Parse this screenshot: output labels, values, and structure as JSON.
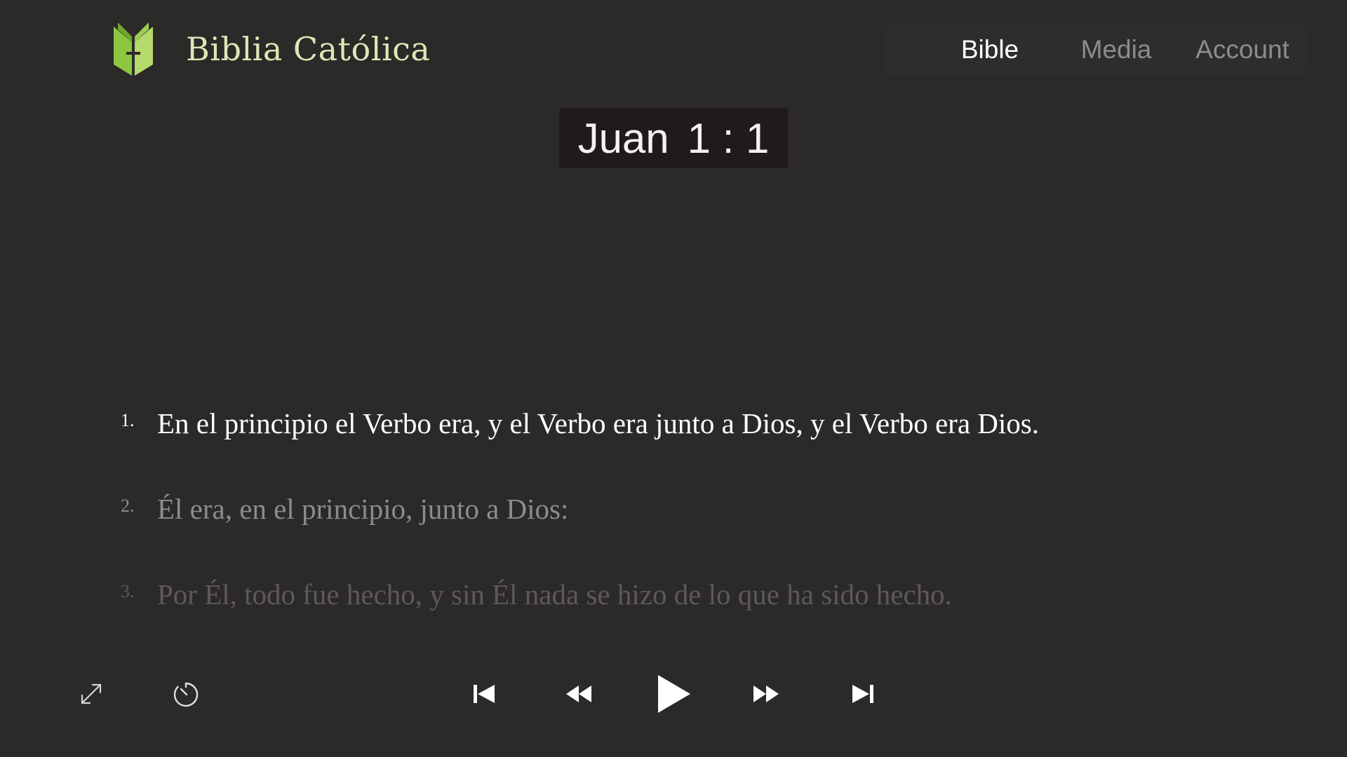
{
  "app": {
    "brand_name": "Biblia Católica"
  },
  "nav": {
    "tabs": [
      {
        "label": "Bible",
        "active": true
      },
      {
        "label": "Media",
        "active": false
      },
      {
        "label": "Account",
        "active": false
      }
    ]
  },
  "reference": {
    "book": "Juan",
    "chapter_verse": "1 : 1"
  },
  "verses": [
    {
      "number": "1.",
      "text": "En el principio el Verbo era, y el Verbo era junto a Dios, y el Verbo era Dios."
    },
    {
      "number": "2.",
      "text": "Él era, en el principio, junto a Dios:"
    },
    {
      "number": "3.",
      "text": "Por Él, todo fue hecho, y sin Él nada se hizo de lo que ha sido hecho."
    }
  ],
  "player": {
    "icons": {
      "expand": "expand-icon",
      "timer": "sleep-timer-icon",
      "first": "skip-to-start-icon",
      "rewind": "rewind-icon",
      "play": "play-icon",
      "forward": "fast-forward-icon",
      "last": "skip-to-end-icon"
    }
  },
  "colors": {
    "background": "#2c2929",
    "brand_text": "#dfe6b6",
    "logo_green": "#8dc63f",
    "active_tab": "#ffffff",
    "inactive_tab": "#8e8b8b"
  }
}
